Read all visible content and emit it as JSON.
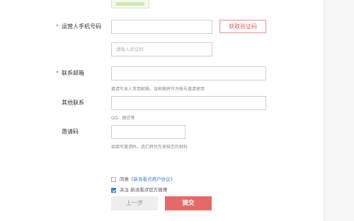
{
  "form": {
    "phone": {
      "required_mark": "*",
      "label": "运营人手机号码",
      "value": "",
      "get_code_button": "获取验证码"
    },
    "code": {
      "placeholder": "请输入验证码"
    },
    "email": {
      "required_mark": "*",
      "label": "联系邮箱",
      "value": "",
      "hint": "邀请写本人常用邮箱，该邮箱将作为帐号邀请使用"
    },
    "other_contact": {
      "label": "其他联系",
      "value": "",
      "hint": "QQ、微信等"
    },
    "invite_code": {
      "label": "邀请码",
      "value": "",
      "hint": "如填写邀请码，我们将优先审核您的材料"
    },
    "agreement": {
      "checked": false,
      "prefix": "同意",
      "link": "《新浪看点用户协议》"
    },
    "follow": {
      "checked": true,
      "text": "关注 新浪看点官方微博"
    },
    "prev_button": "上一步",
    "submit_button": "提交"
  }
}
